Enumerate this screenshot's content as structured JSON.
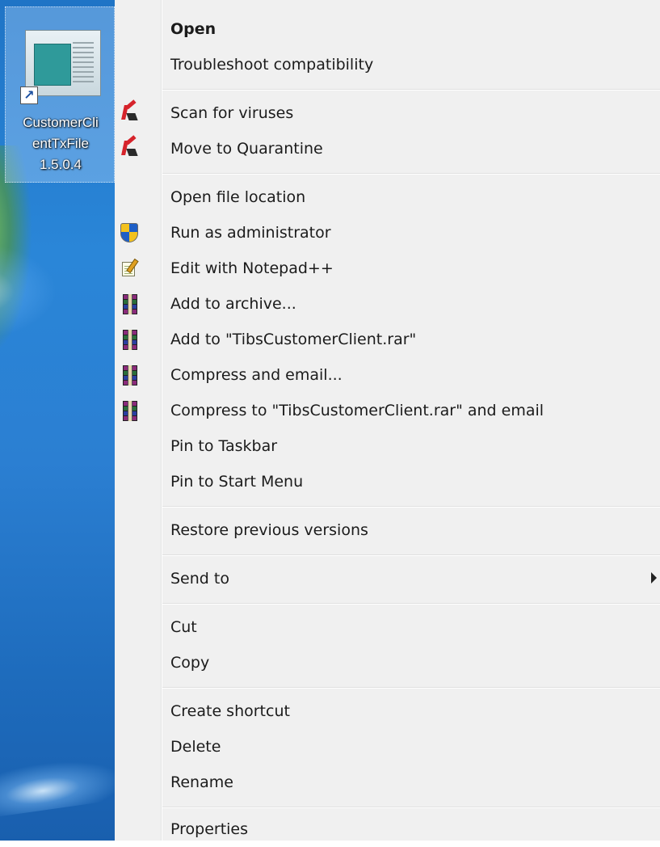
{
  "desktop": {
    "icon": {
      "name_lines": [
        "CustomerCli",
        "entTxFile",
        "1.5.0.4"
      ]
    }
  },
  "menu": {
    "items": [
      {
        "label": "Open",
        "bold": true,
        "icon": ""
      },
      {
        "label": "Troubleshoot compatibility",
        "icon": ""
      },
      {
        "label": "Scan for viruses",
        "icon": "kaspersky-icon"
      },
      {
        "label": "Move to Quarantine",
        "icon": "kaspersky-icon"
      },
      {
        "label": "Open file location",
        "icon": ""
      },
      {
        "label": "Run as administrator",
        "icon": "uac-shield-icon"
      },
      {
        "label": "Edit with Notepad++",
        "icon": "notepad-plus-plus-icon"
      },
      {
        "label": "Add to archive...",
        "icon": "winrar-icon"
      },
      {
        "label": "Add to \"TibsCustomerClient.rar\"",
        "icon": "winrar-icon"
      },
      {
        "label": "Compress and email...",
        "icon": "winrar-icon"
      },
      {
        "label": "Compress to \"TibsCustomerClient.rar\" and email",
        "icon": "winrar-icon"
      },
      {
        "label": "Pin to Taskbar",
        "icon": ""
      },
      {
        "label": "Pin to Start Menu",
        "icon": ""
      },
      {
        "label": "Restore previous versions",
        "icon": ""
      },
      {
        "label": "Send to",
        "icon": "",
        "submenu": true
      },
      {
        "label": "Cut",
        "icon": ""
      },
      {
        "label": "Copy",
        "icon": ""
      },
      {
        "label": "Create shortcut",
        "icon": ""
      },
      {
        "label": "Delete",
        "icon": ""
      },
      {
        "label": "Rename",
        "icon": ""
      },
      {
        "label": "Properties",
        "icon": ""
      }
    ]
  },
  "colors": {
    "menu_background": "#f0f0f0",
    "desktop_blue": "#2a86d8",
    "kaspersky_red": "#d6232b"
  }
}
